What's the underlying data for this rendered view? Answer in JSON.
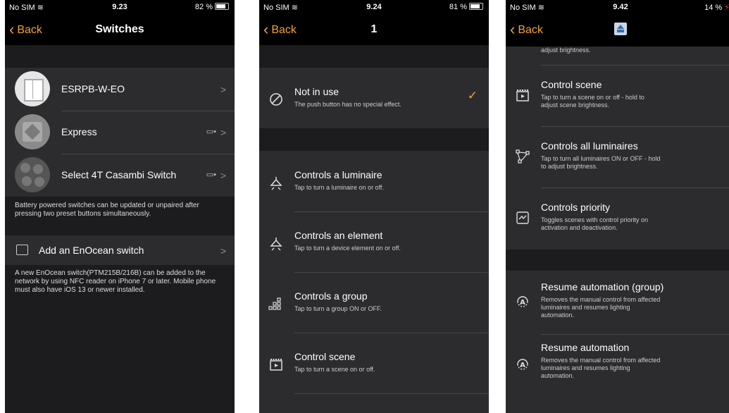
{
  "screen1": {
    "status": {
      "carrier": "No SIM",
      "time": "9.23",
      "battery": "82 %",
      "battery_level": 0.82
    },
    "nav": {
      "back_label": "Back",
      "title": "Switches"
    },
    "switches": [
      {
        "name": "ESRPB-W-EO",
        "icon": "wall-switch-thumbnail",
        "battery_icon": false
      },
      {
        "name": "Express",
        "icon": "express-switch-thumbnail",
        "battery_icon": true
      },
      {
        "name": "Select 4T Casambi Switch",
        "icon": "select-4t-switch-thumbnail",
        "battery_icon": true
      }
    ],
    "battery_note": "Battery powered switches can be updated or unpaired after pressing two preset buttons simultaneously.",
    "add_label": "Add an EnOcean switch",
    "add_note": "A new EnOcean switch(PTM215B/216B) can be added to the network by using NFC reader on iPhone 7 or later. Mobile phone must also have iOS 13 or newer installed."
  },
  "screen2": {
    "status": {
      "carrier": "No SIM",
      "time": "9.24",
      "battery": "81 %",
      "battery_level": 0.81
    },
    "nav": {
      "back_label": "Back",
      "title": "1"
    },
    "not_in_use": {
      "title": "Not in use",
      "subtitle": "The push button has no special effect.",
      "icon": "prohibited-icon",
      "check_icon": "checkmark-icon"
    },
    "options": [
      {
        "title": "Controls a luminaire",
        "subtitle": "Tap to turn a luminaire on or off.",
        "icon": "luminaire-icon"
      },
      {
        "title": "Controls an element",
        "subtitle": "Tap to turn a device element on or off.",
        "icon": "luminaire-icon"
      },
      {
        "title": "Controls a group",
        "subtitle": "Tap to turn a group ON or OFF.",
        "icon": "group-icon"
      },
      {
        "title": "Control scene",
        "subtitle": "Tap to turn a scene on or off.",
        "icon": "scene-icon"
      }
    ]
  },
  "screen3": {
    "status": {
      "carrier": "No SIM",
      "time": "9.42",
      "battery": "14 %",
      "battery_level": 0.14
    },
    "nav": {
      "back_label": "Back",
      "title_icon": "automation-title-icon"
    },
    "top_fragment": "adjust brightness.",
    "options": [
      {
        "title": "Control scene",
        "subtitle": [
          "Tap to turn a scene on or off - hold to",
          "adjust scene brightness."
        ],
        "icon": "scene-icon"
      },
      {
        "title": "Controls all luminaires",
        "subtitle": [
          "Tap to turn all luminaires ON or OFF - hold",
          "to adjust brightness."
        ],
        "icon": "network-icon"
      },
      {
        "title": "Controls priority",
        "subtitle": [
          "Toggles scenes with control priority on",
          "activation and deactivation."
        ],
        "icon": "priority-icon"
      }
    ],
    "automation": [
      {
        "title": "Resume automation (group)",
        "subtitle": [
          "Removes the manual control from affected",
          "luminaires and resumes lighting",
          "automation."
        ],
        "icon": "resume-automation-icon"
      },
      {
        "title": "Resume automation",
        "subtitle": [
          "Removes the manual control from affected",
          "luminaires and resumes lighting",
          "automation."
        ],
        "icon": "resume-automation-icon"
      }
    ]
  },
  "colors": {
    "accent": "#f0a23a",
    "cell": "#2c2c2e",
    "group_gap": "#1c1c1e",
    "background": "#000000"
  }
}
